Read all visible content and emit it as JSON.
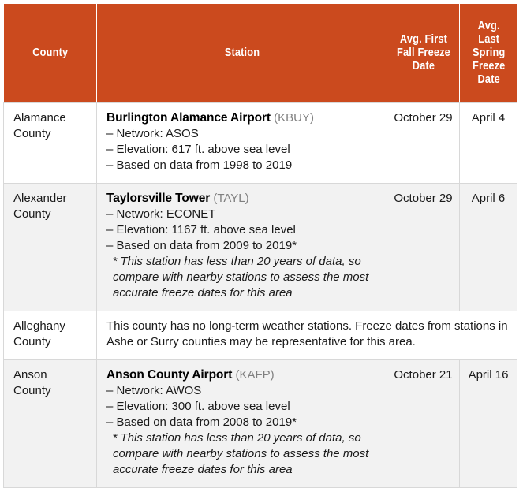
{
  "table": {
    "columns": [
      {
        "key": "county",
        "label": "County"
      },
      {
        "key": "station",
        "label": "Station"
      },
      {
        "key": "fall",
        "label": "Avg. First Fall Freeze Date"
      },
      {
        "key": "spring",
        "label": "Avg. Last Spring Freeze Date"
      }
    ],
    "header_bg": "#CB4A1E",
    "header_text_color": "#FFFFFF",
    "stripe_bg": "#F2F2F2",
    "rows": [
      {
        "county": "Alamance\nCounty",
        "station_name": "Burlington Alamance Airport",
        "station_code": "(KBUY)",
        "details": [
          "– Network: ASOS",
          "– Elevation: 617 ft. above sea level",
          "– Based on data from 1998 to 2019"
        ],
        "footnote": "",
        "fall": "October 29",
        "spring": "April 4",
        "striped": false,
        "full_width_note": ""
      },
      {
        "county": "Alexander\nCounty",
        "station_name": "Taylorsville Tower",
        "station_code": "(TAYL)",
        "details": [
          "– Network: ECONET",
          "– Elevation: 1167 ft. above sea level",
          "– Based on data from 2009 to 2019*"
        ],
        "footnote": "* This station has less than 20 years of data, so compare with nearby stations to assess the most accurate freeze dates for this area",
        "fall": "October 29",
        "spring": "April 6",
        "striped": true,
        "full_width_note": ""
      },
      {
        "county": "Alleghany\nCounty",
        "station_name": "",
        "station_code": "",
        "details": [],
        "footnote": "",
        "fall": "",
        "spring": "",
        "striped": false,
        "full_width_note": "This county has no long-term weather stations. Freeze dates from stations in Ashe or Surry counties may be representative for this area."
      },
      {
        "county": "Anson\nCounty",
        "station_name": "Anson County Airport",
        "station_code": "(KAFP)",
        "details": [
          "– Network: AWOS",
          "– Elevation: 300 ft. above sea level",
          "– Based on data from 2008 to 2019*"
        ],
        "footnote": "* This station has less than 20 years of data, so compare with nearby stations to assess the most accurate freeze dates for this area",
        "fall": "October 21",
        "spring": "April 16",
        "striped": true,
        "full_width_note": ""
      }
    ]
  }
}
